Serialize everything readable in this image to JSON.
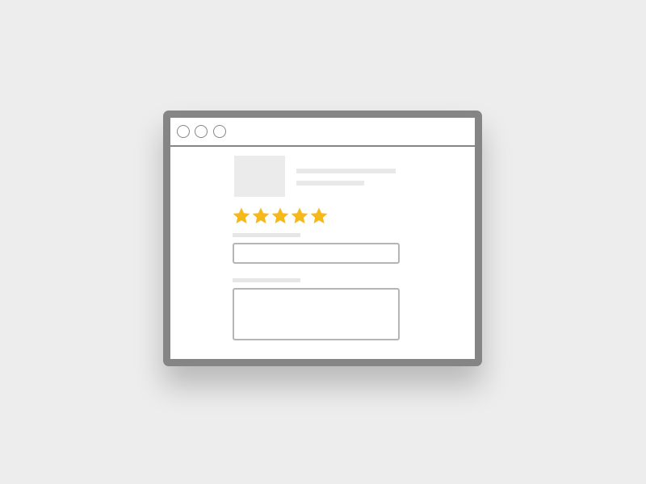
{
  "window": {
    "frame_color": "#858585",
    "background": "#ffffff",
    "controls": [
      "circle-button",
      "circle-button",
      "circle-button"
    ]
  },
  "product": {
    "thumbnail_icon": "image-placeholder",
    "title": "",
    "subtitle": ""
  },
  "rating": {
    "value": 5,
    "max": 5,
    "star_color": "#f5b719"
  },
  "form": {
    "input": {
      "label": "",
      "value": "",
      "placeholder": ""
    },
    "textarea": {
      "label": "",
      "value": "",
      "placeholder": ""
    }
  }
}
